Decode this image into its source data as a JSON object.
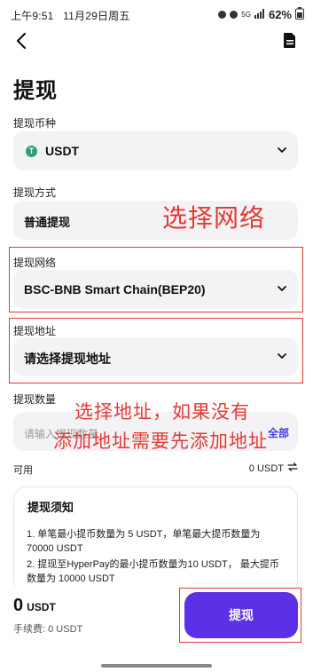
{
  "status_bar": {
    "time": "上午9:51",
    "date": "11月29日周五",
    "signal": "5G",
    "battery": "62%"
  },
  "header": {
    "back_icon": "chevron-left-icon",
    "record_icon": "document-icon"
  },
  "page": {
    "title": "提现"
  },
  "currency": {
    "label": "提现币种",
    "value": "USDT",
    "logo_text": "T"
  },
  "method": {
    "label": "提现方式",
    "value": "普通提现"
  },
  "network": {
    "label": "提现网络",
    "value": "BSC-BNB Smart Chain(BEP20)"
  },
  "address": {
    "label": "提现地址",
    "value": "请选择提现地址"
  },
  "quantity": {
    "label": "提现数量",
    "placeholder": "请输入提现数量",
    "all_label": "全部"
  },
  "available": {
    "label": "可用",
    "value": "0 USDT"
  },
  "notice": {
    "title": "提现须知",
    "items": [
      "1. 单笔最小提币数量为 5 USDT，单笔最大提币数量为70000 USDT",
      "2. 提现至HyperPay的最小提币数量为10 USDT， 最大提币数量为 10000 USDT"
    ]
  },
  "footer": {
    "amount": "0",
    "amount_unit": "USDT",
    "fee": "手续费: 0 USDT",
    "submit_label": "提现"
  },
  "annotations": {
    "network_hint": "选择网络",
    "address_hint_line1": "选择地址，如果没有",
    "address_hint_line2": "添加地址需要先添加地址"
  },
  "colors": {
    "accent": "#5c30e6",
    "annotation": "#e53935",
    "usdt": "#26a17b",
    "field_bg": "#f3f3f5"
  }
}
